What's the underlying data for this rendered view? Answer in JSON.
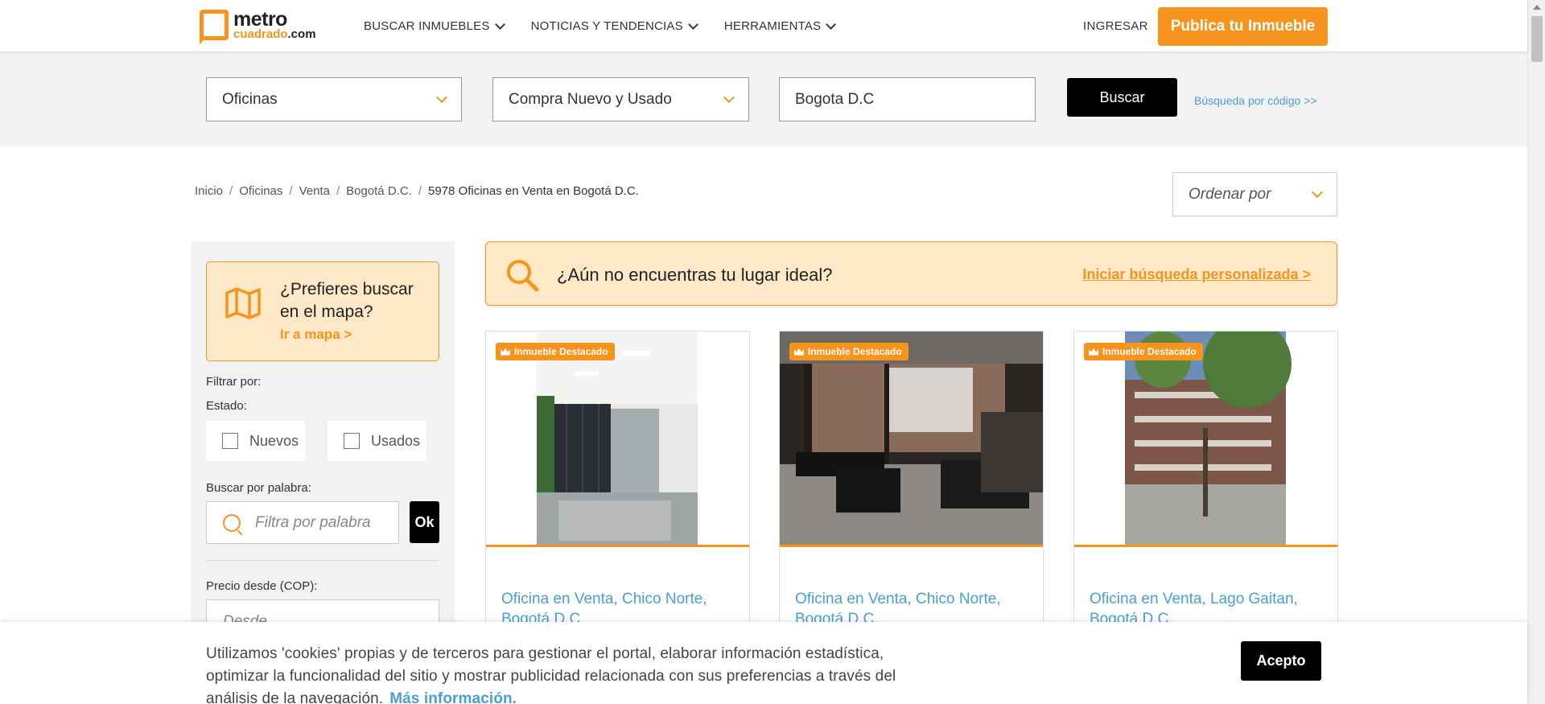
{
  "header": {
    "logo_top": "metro",
    "logo_bottom": "cuadrado",
    "logo_tld": ".com",
    "nav": [
      {
        "label": "BUSCAR INMUEBLES"
      },
      {
        "label": "NOTICIAS Y TENDENCIAS"
      },
      {
        "label": "HERRAMIENTAS"
      }
    ],
    "login": "INGRESAR",
    "publish": "Publica tu Inmueble"
  },
  "search": {
    "tipo": "Oficinas",
    "transaccion": "Compra Nuevo y Usado",
    "ciudad": "Bogota D.C",
    "buscar": "Buscar",
    "codigo": "Búsqueda por código >>"
  },
  "breadcrumb": {
    "items": [
      "Inicio",
      "Oficinas",
      "Venta",
      "Bogotá D.C."
    ],
    "current": "5978 Oficinas en Venta en Bogotá D.C."
  },
  "sort": {
    "placeholder": "Ordenar por"
  },
  "sidebar": {
    "map_question": "¿Prefieres buscar en el mapa?",
    "map_link": "Ir a mapa >",
    "filter_label": "Filtrar por:",
    "estado_label": "Estado:",
    "nuevos": "Nuevos",
    "usados": "Usados",
    "keyword_label": "Buscar por palabra:",
    "keyword_placeholder": "Filtra por palabra",
    "ok": "Ok",
    "price_label": "Precio desde (COP):",
    "price_placeholder": "Desde"
  },
  "banner": {
    "text": "¿Aún no encuentras tu lugar ideal?",
    "link": "Iniciar búsqueda personalizada >"
  },
  "listings": [
    {
      "badge": "Inmueble Destacado",
      "title": "Oficina en Venta, Chico Norte, Bogotá D.C."
    },
    {
      "badge": "Inmueble Destacado",
      "title": "Oficina en Venta, Chico Norte, Bogotá D.C."
    },
    {
      "badge": "Inmueble Destacado",
      "title": "Oficina en Venta, Lago Gaitan, Bogotá D.C."
    }
  ],
  "cookie": {
    "text": "Utilizamos 'cookies' propias y de terceros para gestionar el portal, elaborar información estadística, optimizar la funcionalidad del sitio y mostrar publicidad relacionada con sus preferencias a través del análisis de la navegación.",
    "more": "Más información.",
    "accept": "Acepto"
  },
  "colors": {
    "accent": "#f7941d",
    "link": "#4a9fd3",
    "banner_bg": "#fde9c8"
  }
}
